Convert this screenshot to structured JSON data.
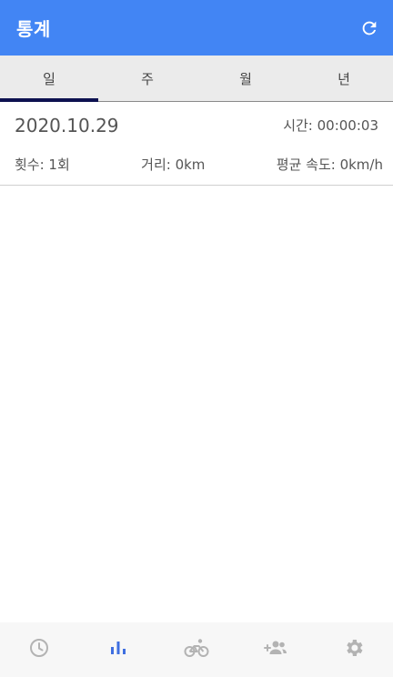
{
  "appbar": {
    "title": "통계",
    "refresh_icon": "refresh-icon"
  },
  "tabs": [
    {
      "label": "일",
      "active": true
    },
    {
      "label": "주",
      "active": false
    },
    {
      "label": "월",
      "active": false
    },
    {
      "label": "년",
      "active": false
    }
  ],
  "record": {
    "date": "2020.10.29",
    "time": "시간: 00:00:03",
    "count": "횟수: 1회",
    "distance": "거리: 0km",
    "avg_speed": "평균 속도: 0km/h"
  },
  "bottom_nav": [
    {
      "icon": "clock-icon",
      "active": false
    },
    {
      "icon": "bar-chart-icon",
      "active": true
    },
    {
      "icon": "bicycle-icon",
      "active": false
    },
    {
      "icon": "add-friend-icon",
      "active": false
    },
    {
      "icon": "gear-icon",
      "active": false
    }
  ],
  "colors": {
    "primary": "#4285f4",
    "tab_indicator": "#0d1150",
    "nav_active": "#3f6fe0",
    "nav_inactive": "#b3b3b3"
  }
}
